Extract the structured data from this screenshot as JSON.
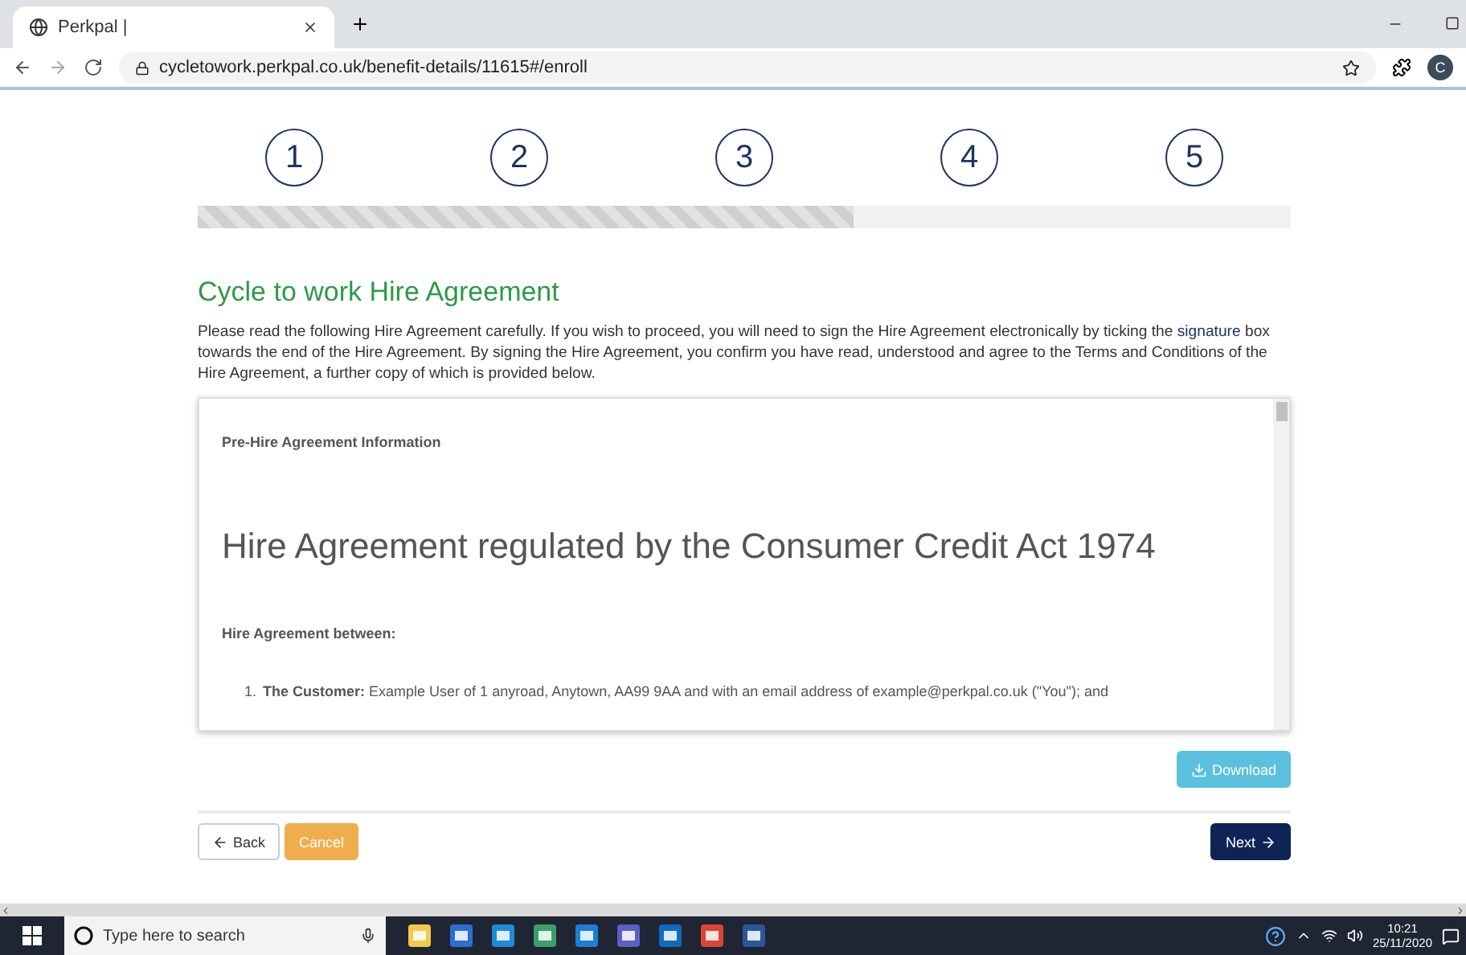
{
  "browser": {
    "tab_title": "Perkpal |",
    "url": "cycletowork.perkpal.co.uk/benefit-details/11615#/enroll",
    "profile_initial": "C"
  },
  "steps": [
    {
      "label": "1"
    },
    {
      "label": "2"
    },
    {
      "label": "3"
    },
    {
      "label": "4"
    },
    {
      "label": "5"
    }
  ],
  "progress": {
    "level": 0.6
  },
  "page": {
    "title": "Cycle to work Hire Agreement",
    "intro_before": "Please read the following Hire Agreement carefully. If you wish to proceed, you will need to sign the Hire Agreement electronically by ticking the",
    "intro_link": "signature",
    "intro_after": "box towards the end of the Hire Agreement. By signing the Hire Agreement, you confirm you have read, understood and agree to the Terms and Conditions of the Hire Agreement, a further copy of which is provided below."
  },
  "document": {
    "heading": "Pre-Hire Agreement Information",
    "title": "Hire Agreement regulated by the Consumer Credit Act 1974",
    "subheading": "Hire Agreement between:",
    "items": [
      {
        "number": "1.",
        "text": "**The Customer:** Example User of 1 anyroad, Anytown, AA99 9AA and with an email address of example@perkpal.co.uk (\"You\"); and"
      }
    ]
  },
  "buttons": {
    "download": "Download",
    "back": "Back",
    "cancel": "Cancel",
    "next": "Next"
  },
  "taskbar": {
    "search_placeholder": "Type here to search",
    "time": "10:21",
    "date": "25/11/2020"
  }
}
